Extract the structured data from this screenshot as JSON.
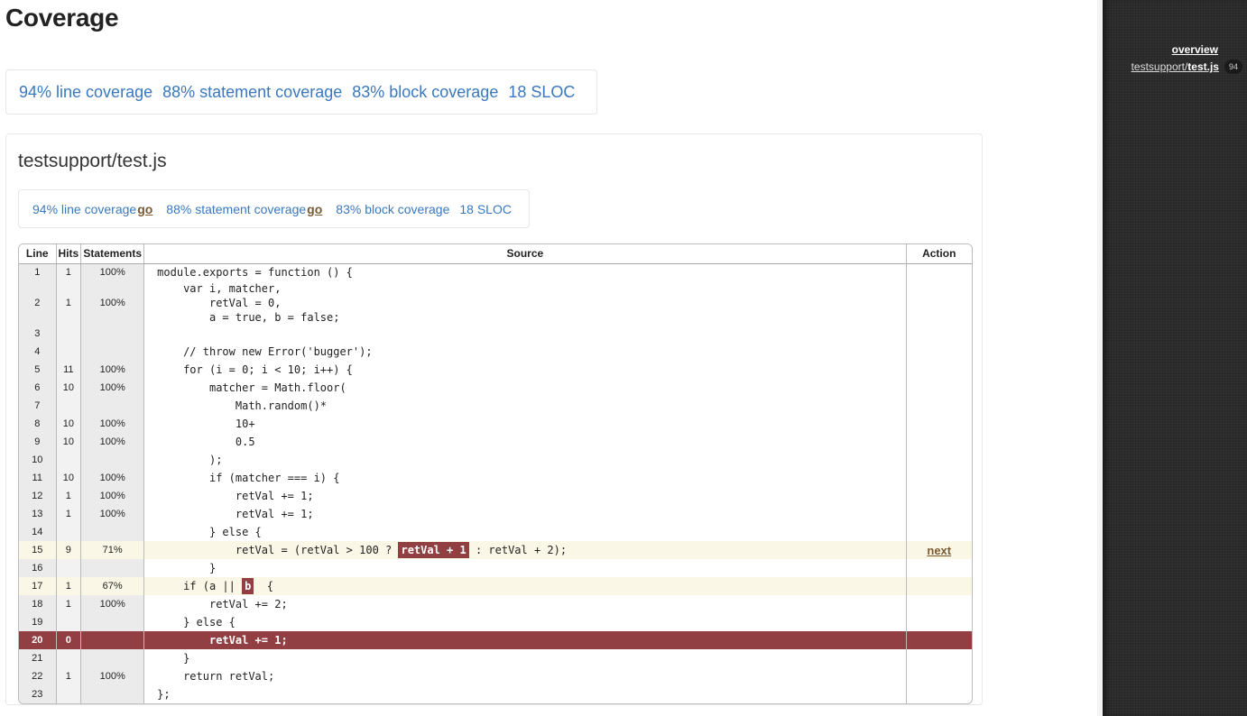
{
  "page": {
    "title": "Coverage"
  },
  "summary": {
    "line": "94% line coverage",
    "statement": "88% statement coverage",
    "block": "83% block coverage",
    "sloc": "18 SLOC"
  },
  "file": {
    "name": "testsupport/test.js",
    "summary": {
      "line": "94% line coverage",
      "line_go": "go",
      "statement": "88% statement coverage",
      "statement_go": "go",
      "block": "83% block coverage",
      "sloc": "18 SLOC"
    },
    "table": {
      "headers": [
        "Line",
        "Hits",
        "Statements",
        "Source",
        "Action"
      ],
      "rows": [
        {
          "line": "1",
          "hits": "1",
          "stmt": "100%",
          "src": "module.exports = function () {",
          "status": "covered"
        },
        {
          "line": "2",
          "hits": "1",
          "stmt": "100%",
          "src": "    var i, matcher,\n        retVal = 0,\n        a = true, b = false;",
          "status": "covered"
        },
        {
          "line": "3",
          "hits": "",
          "stmt": "",
          "src": "",
          "status": "none"
        },
        {
          "line": "4",
          "hits": "",
          "stmt": "",
          "src": "    // throw new Error('bugger');",
          "status": "none"
        },
        {
          "line": "5",
          "hits": "11",
          "stmt": "100%",
          "src": "    for (i = 0; i < 10; i++) {",
          "status": "covered"
        },
        {
          "line": "6",
          "hits": "10",
          "stmt": "100%",
          "src": "        matcher = Math.floor(",
          "status": "covered"
        },
        {
          "line": "7",
          "hits": "",
          "stmt": "",
          "src": "            Math.random()*",
          "status": "none"
        },
        {
          "line": "8",
          "hits": "10",
          "stmt": "100%",
          "src": "            10+",
          "status": "covered"
        },
        {
          "line": "9",
          "hits": "10",
          "stmt": "100%",
          "src": "            0.5",
          "status": "covered"
        },
        {
          "line": "10",
          "hits": "",
          "stmt": "",
          "src": "        );",
          "status": "none"
        },
        {
          "line": "11",
          "hits": "10",
          "stmt": "100%",
          "src": "        if (matcher === i) {",
          "status": "covered"
        },
        {
          "line": "12",
          "hits": "1",
          "stmt": "100%",
          "src": "            retVal += 1;",
          "status": "covered"
        },
        {
          "line": "13",
          "hits": "1",
          "stmt": "100%",
          "src": "            retVal += 1;",
          "status": "covered"
        },
        {
          "line": "14",
          "hits": "",
          "stmt": "",
          "src": "        } else {",
          "status": "none"
        },
        {
          "line": "15",
          "hits": "9",
          "stmt": "71%",
          "src_before": "            retVal = (retVal > 100 ? ",
          "src_hl": "retVal + 1",
          "src_after": " : retVal + 2);",
          "status": "partial",
          "action": "next"
        },
        {
          "line": "16",
          "hits": "",
          "stmt": "",
          "src": "        }",
          "status": "none"
        },
        {
          "line": "17",
          "hits": "1",
          "stmt": "67%",
          "src_before": "    if (a || ",
          "src_hl": "b",
          "src_after": "  {",
          "status": "partial"
        },
        {
          "line": "18",
          "hits": "1",
          "stmt": "100%",
          "src": "        retVal += 2;",
          "status": "covered"
        },
        {
          "line": "19",
          "hits": "",
          "stmt": "",
          "src": "    } else {",
          "status": "none"
        },
        {
          "line": "20",
          "hits": "0",
          "stmt": "",
          "src": "        retVal += 1;",
          "status": "missed"
        },
        {
          "line": "21",
          "hits": "",
          "stmt": "",
          "src": "    }",
          "status": "none"
        },
        {
          "line": "22",
          "hits": "1",
          "stmt": "100%",
          "src": "    return retVal;",
          "status": "covered"
        },
        {
          "line": "23",
          "hits": "",
          "stmt": "",
          "src": "};",
          "status": "none"
        }
      ]
    }
  },
  "sidebar": {
    "overview_label": "overview",
    "file_dir": "testsupport/",
    "file_name": "test.js",
    "file_badge": "94"
  },
  "colors": {
    "link_blue": "#3a78bf",
    "go_brown": "#7a5a32",
    "missed_red": "#913f42",
    "partial_yellow": "#fbf7e6",
    "sidebar_dark": "#2c2c2c"
  }
}
